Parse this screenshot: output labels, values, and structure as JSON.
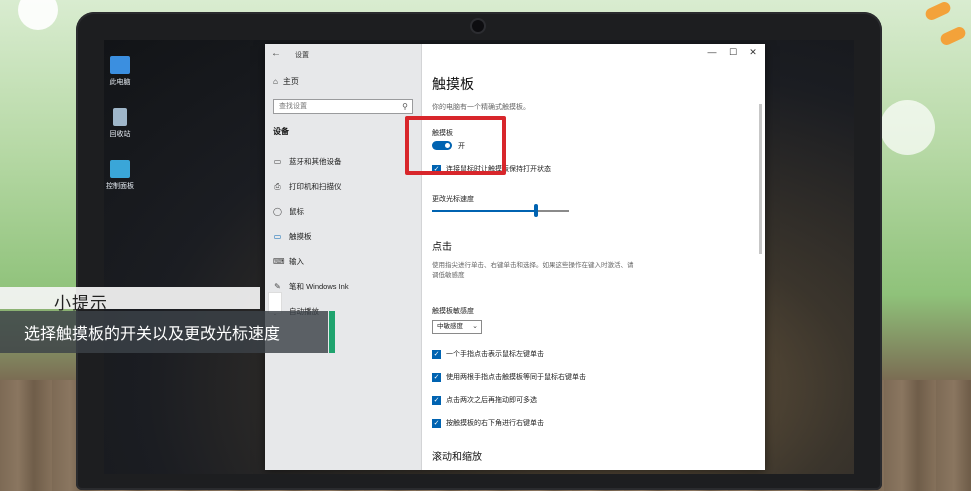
{
  "window": {
    "title": "设置",
    "back": "←",
    "minimize": "—",
    "maximize": "☐",
    "close": "✕"
  },
  "desktop": {
    "icons": [
      {
        "label": "此电脑",
        "color": "#3b8fe0"
      },
      {
        "label": "回收站",
        "color": "#9fb6c9"
      },
      {
        "label": "控制面板",
        "color": "#3aa6d8"
      }
    ]
  },
  "sidebar": {
    "home": "主页",
    "search_placeholder": "查找设置",
    "section": "设备",
    "items": [
      {
        "label": "蓝牙和其他设备",
        "icon": "▭"
      },
      {
        "label": "打印机和扫描仪",
        "icon": "⎙"
      },
      {
        "label": "鼠标",
        "icon": "◯"
      },
      {
        "label": "触摸板",
        "icon": "▭"
      },
      {
        "label": "输入",
        "icon": "⌨"
      },
      {
        "label": "笔和 Windows Ink",
        "icon": "✎"
      },
      {
        "label": "自动播放",
        "icon": "▶"
      }
    ]
  },
  "main": {
    "title": "触摸板",
    "description": "你的电脑有一个精确式触摸板。",
    "touchpad_label": "触摸板",
    "toggle_state": "开",
    "toggle_on": true,
    "keep_on_label": "连接鼠标时让触摸板保持打开状态",
    "cursor_speed_label": "更改光标速度",
    "cursor_speed": 0.76,
    "tap_heading": "点击",
    "tap_description": "使用指尖进行单击、右键单击和选择。如果这些操作在键入时激活、请调低敏感度",
    "sensitivity_label": "触摸板敏感度",
    "sensitivity_value": "中敏感度",
    "options": [
      "一个手指点击表示鼠标左键单击",
      "使用两根手指点击触摸板等同于鼠标右键单击",
      "点击两次之后再拖动即可多选",
      "按触摸板的右下角进行右键单击"
    ],
    "scroll_heading": "滚动和缩放"
  },
  "tip": {
    "title": "小提示",
    "text": "选择触摸板的开关以及更改光标速度"
  },
  "colors": {
    "accent": "#0063b1",
    "highlight": "#d8262b",
    "tip_accent": "#1fa36e"
  }
}
